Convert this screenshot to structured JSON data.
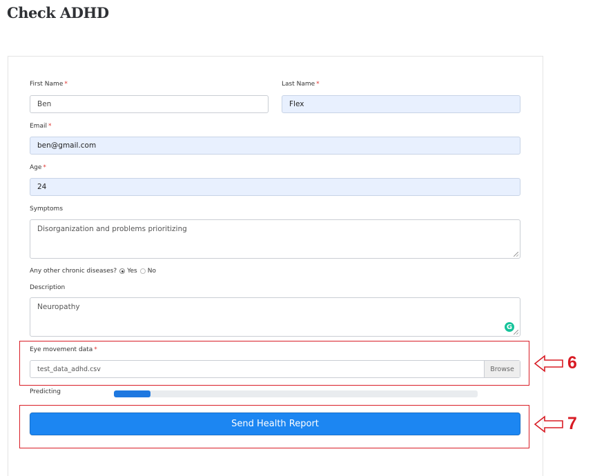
{
  "page": {
    "title": "Check ADHD"
  },
  "form": {
    "required_mark": "*",
    "first_name": {
      "label": "First Name",
      "value": "Ben"
    },
    "last_name": {
      "label": "Last Name",
      "value": "Flex"
    },
    "email": {
      "label": "Email",
      "value": "ben@gmail.com"
    },
    "age": {
      "label": "Age",
      "value": "24"
    },
    "symptoms": {
      "label": "Symptoms",
      "value": "Disorganization and problems prioritizing"
    },
    "chronic": {
      "question": "Any other chronic diseases?",
      "options": [
        "Yes",
        "No"
      ],
      "selected": "Yes"
    },
    "description": {
      "label": "Description",
      "value": "Neuropathy"
    },
    "eye_data": {
      "label": "Eye movement data",
      "file_name": "test_data_adhd.csv",
      "browse_label": "Browse"
    },
    "progress": {
      "label": "Predicting",
      "fraction": 0.1
    },
    "submit_label": "Send Health Report"
  },
  "annotations": {
    "step_a": "6",
    "step_b": "7",
    "color": "#d81b24"
  },
  "colors": {
    "accent": "#1c86f2",
    "autofill": "#e8f0fe",
    "required": "#e0342f",
    "grammarly": "#15c39a"
  }
}
